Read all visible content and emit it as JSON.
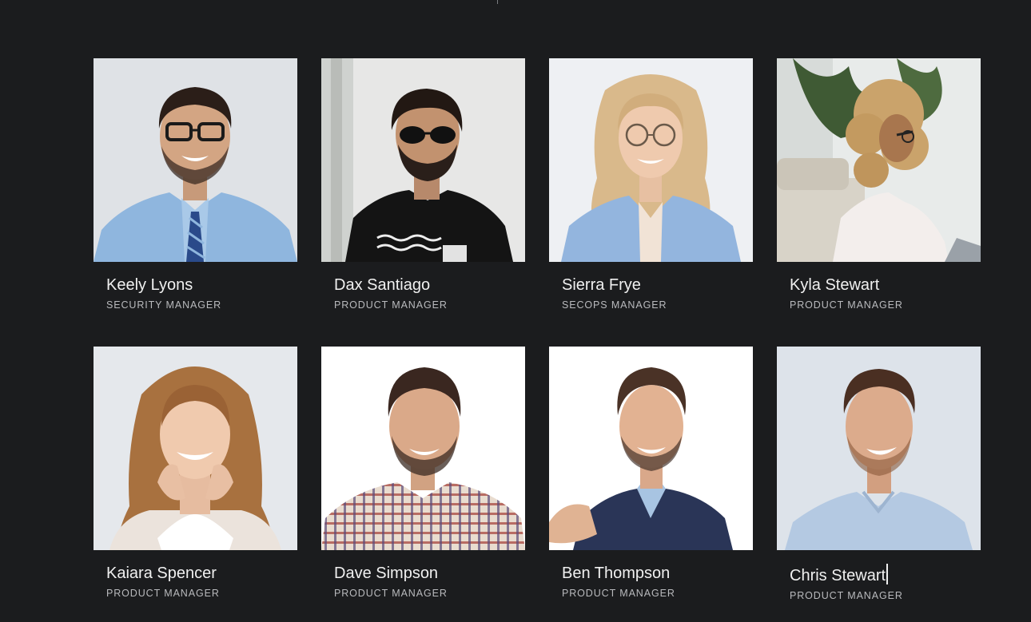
{
  "team": {
    "members": [
      {
        "name": "Keely Lyons",
        "role": "SECURITY MANAGER",
        "photo_icon": "portrait-man-glasses-tie-icon"
      },
      {
        "name": "Dax Santiago",
        "role": "PRODUCT MANAGER",
        "photo_icon": "portrait-man-sunglasses-icon"
      },
      {
        "name": "Sierra Frye",
        "role": "SECOPS MANAGER",
        "photo_icon": "portrait-woman-glasses-icon"
      },
      {
        "name": "Kyla Stewart",
        "role": "PRODUCT MANAGER",
        "photo_icon": "portrait-woman-curly-hair-icon"
      },
      {
        "name": "Kaiara Spencer",
        "role": "PRODUCT MANAGER",
        "photo_icon": "portrait-woman-smiling-icon"
      },
      {
        "name": "Dave Simpson",
        "role": "PRODUCT MANAGER",
        "photo_icon": "portrait-man-plaid-shirt-icon"
      },
      {
        "name": "Ben Thompson",
        "role": "PRODUCT MANAGER",
        "photo_icon": "portrait-man-sweater-icon"
      },
      {
        "name": "Chris Stewart",
        "role": "PRODUCT MANAGER",
        "photo_icon": "portrait-man-blue-shirt-icon"
      }
    ]
  },
  "colors": {
    "background": "#1b1c1e",
    "name_text": "#f0f0f0",
    "role_text": "#b9babd"
  }
}
